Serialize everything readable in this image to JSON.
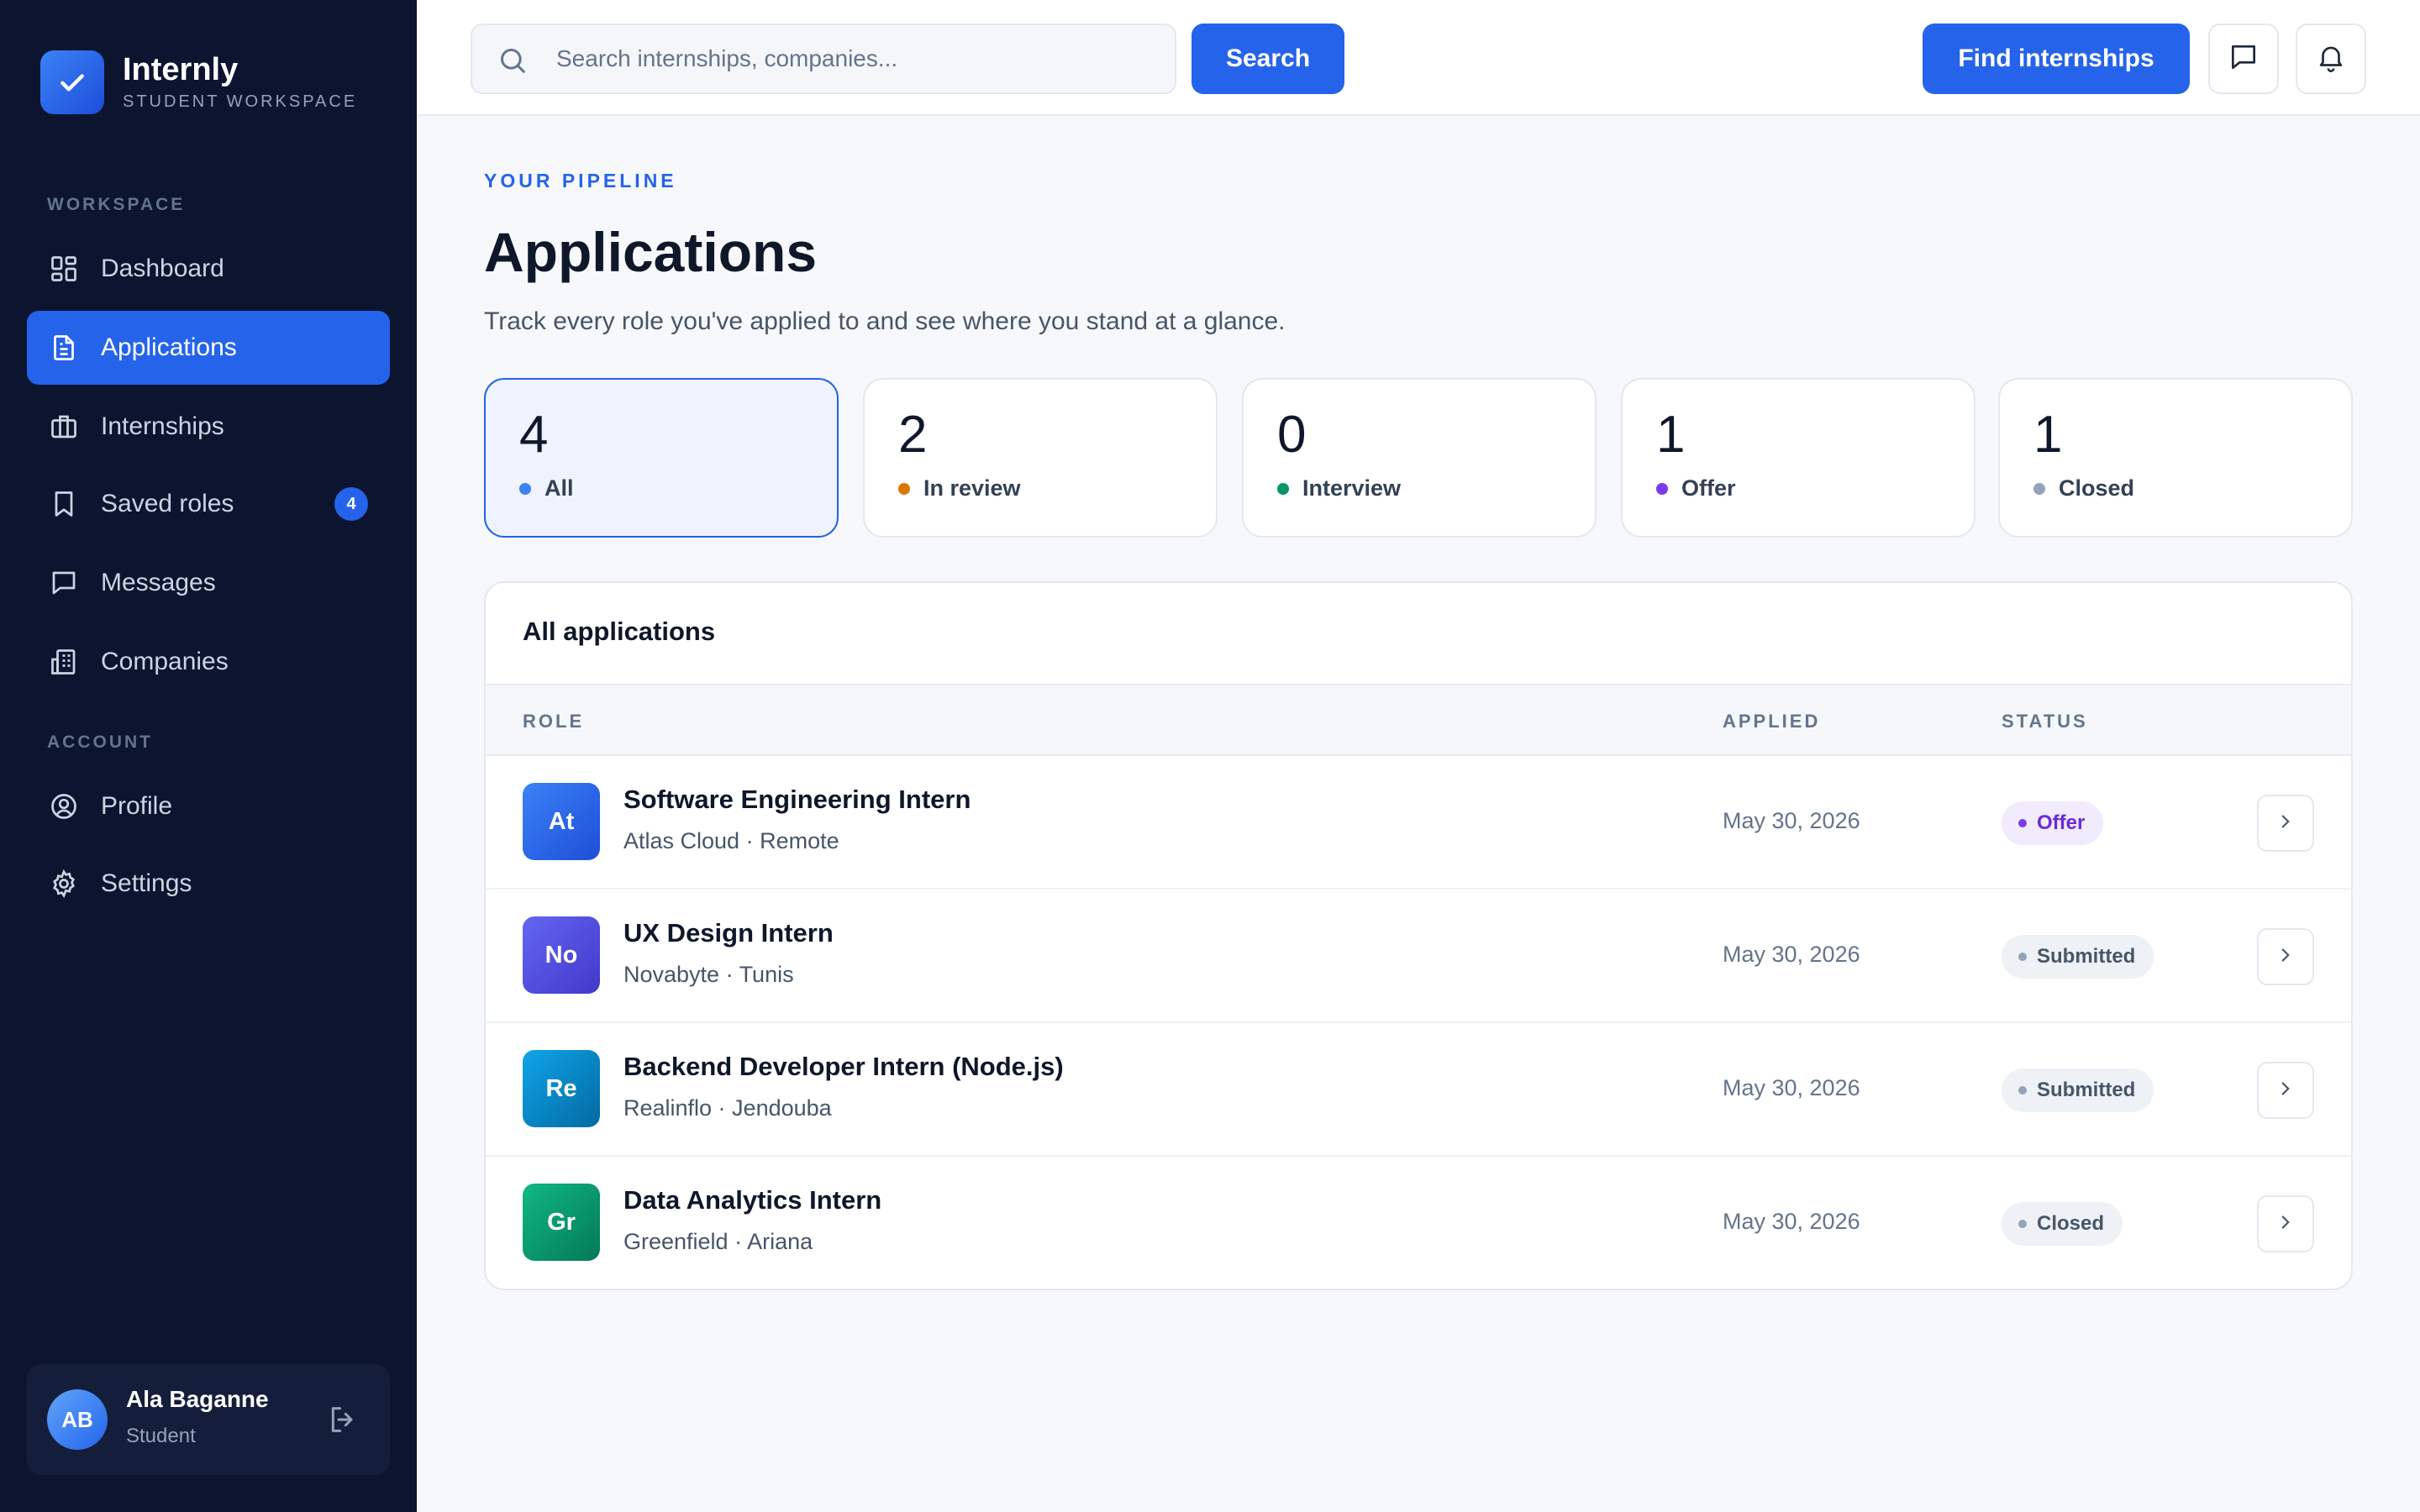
{
  "brand": {
    "name": "Internly",
    "subtitle": "STUDENT WORKSPACE"
  },
  "sidebar": {
    "workspace_label": "WORKSPACE",
    "account_label": "ACCOUNT",
    "items": [
      {
        "label": "Dashboard",
        "icon": "dashboard-icon"
      },
      {
        "label": "Applications",
        "icon": "document-icon",
        "active": true
      },
      {
        "label": "Internships",
        "icon": "briefcase-icon"
      },
      {
        "label": "Saved roles",
        "icon": "bookmark-icon",
        "badge": "4"
      },
      {
        "label": "Messages",
        "icon": "message-icon"
      },
      {
        "label": "Companies",
        "icon": "building-icon"
      }
    ],
    "account_items": [
      {
        "label": "Profile",
        "icon": "user-circle-icon"
      },
      {
        "label": "Settings",
        "icon": "gear-icon"
      }
    ]
  },
  "user": {
    "initials": "AB",
    "name": "Ala Baganne",
    "role": "Student"
  },
  "topbar": {
    "search_placeholder": "Search internships, companies...",
    "search_button": "Search",
    "find_button": "Find internships"
  },
  "page": {
    "eyebrow": "YOUR PIPELINE",
    "title": "Applications",
    "description": "Track every role you've applied to and see where you stand at a glance."
  },
  "stats": [
    {
      "count": "4",
      "label": "All",
      "color": "#3b82f6",
      "active": true
    },
    {
      "count": "2",
      "label": "In review",
      "color": "#d97706"
    },
    {
      "count": "0",
      "label": "Interview",
      "color": "#059669"
    },
    {
      "count": "1",
      "label": "Offer",
      "color": "#7c3aed"
    },
    {
      "count": "1",
      "label": "Closed",
      "color": "#94a3b8"
    }
  ],
  "table": {
    "title": "All applications",
    "headers": {
      "role": "ROLE",
      "applied": "APPLIED",
      "status": "STATUS"
    },
    "rows": [
      {
        "initials": "At",
        "title": "Software Engineering Intern",
        "subtitle": "Atlas Cloud · Remote",
        "applied": "May 30, 2026",
        "status": "Offer"
      },
      {
        "initials": "No",
        "title": "UX Design Intern",
        "subtitle": "Novabyte · Tunis",
        "applied": "May 30, 2026",
        "status": "Submitted"
      },
      {
        "initials": "Re",
        "title": "Backend Developer Intern (Node.js)",
        "subtitle": "Realinflo · Jendouba",
        "applied": "May 30, 2026",
        "status": "Submitted"
      },
      {
        "initials": "Gr",
        "title": "Data Analytics Intern",
        "subtitle": "Greenfield · Ariana",
        "applied": "May 30, 2026",
        "status": "Closed"
      }
    ]
  },
  "colors": {
    "accent": "#2563eb",
    "sidebar_bg": "#0c1430",
    "offer_text": "#6d28d9",
    "offer_bg": "#f1ebfe",
    "neutral_pill_bg": "#eef1f5"
  }
}
